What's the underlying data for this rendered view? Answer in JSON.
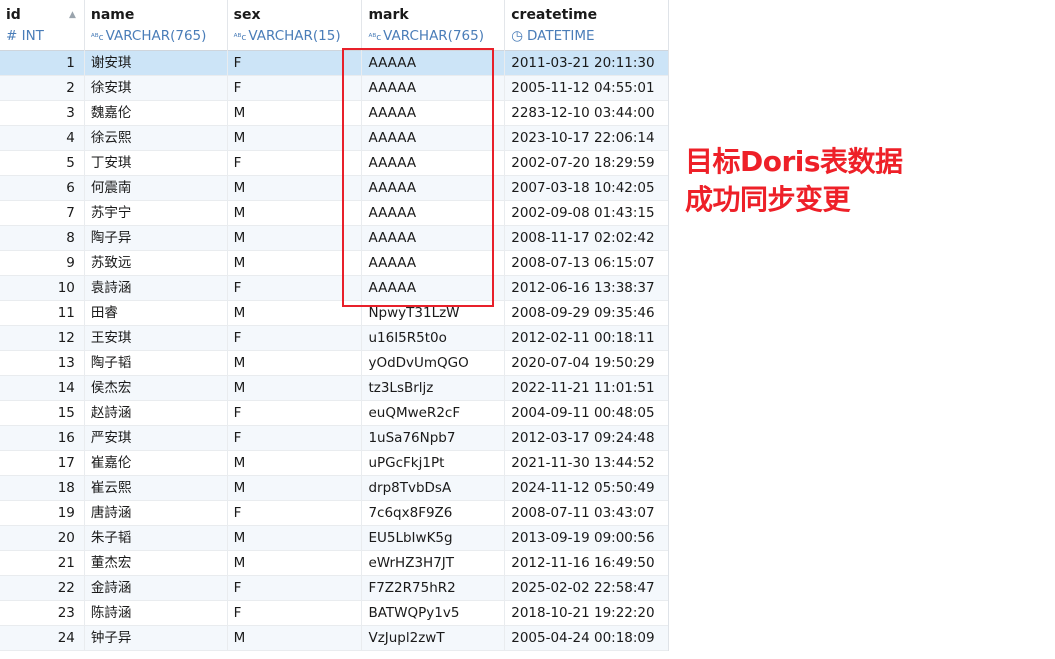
{
  "columns": [
    {
      "name": "id",
      "type": "# INT",
      "type_icon": "hash-icon"
    },
    {
      "name": "name",
      "type": "VARCHAR(765)",
      "type_icon": "text-type-icon"
    },
    {
      "name": "sex",
      "type": "VARCHAR(15)",
      "type_icon": "text-type-icon"
    },
    {
      "name": "mark",
      "type": "VARCHAR(765)",
      "type_icon": "text-type-icon"
    },
    {
      "name": "createtime",
      "type": "DATETIME",
      "type_icon": "clock-icon"
    }
  ],
  "type_icon_text": "ᴬᴮc",
  "clock_glyph": "◷",
  "rows": [
    {
      "id": "1",
      "name": "谢安琪",
      "sex": "F",
      "mark": "AAAAA",
      "createtime": "2011-03-21 20:11:30"
    },
    {
      "id": "2",
      "name": "徐安琪",
      "sex": "F",
      "mark": "AAAAA",
      "createtime": "2005-11-12 04:55:01"
    },
    {
      "id": "3",
      "name": "魏嘉伦",
      "sex": "M",
      "mark": "AAAAA",
      "createtime": "2283-12-10 03:44:00"
    },
    {
      "id": "4",
      "name": "徐云熙",
      "sex": "M",
      "mark": "AAAAA",
      "createtime": "2023-10-17 22:06:14"
    },
    {
      "id": "5",
      "name": "丁安琪",
      "sex": "F",
      "mark": "AAAAA",
      "createtime": "2002-07-20 18:29:59"
    },
    {
      "id": "6",
      "name": "何震南",
      "sex": "M",
      "mark": "AAAAA",
      "createtime": "2007-03-18 10:42:05"
    },
    {
      "id": "7",
      "name": "苏宇宁",
      "sex": "M",
      "mark": "AAAAA",
      "createtime": "2002-09-08 01:43:15"
    },
    {
      "id": "8",
      "name": "陶子异",
      "sex": "M",
      "mark": "AAAAA",
      "createtime": "2008-11-17 02:02:42"
    },
    {
      "id": "9",
      "name": "苏致远",
      "sex": "M",
      "mark": "AAAAA",
      "createtime": "2008-07-13 06:15:07"
    },
    {
      "id": "10",
      "name": "袁詩涵",
      "sex": "F",
      "mark": "AAAAA",
      "createtime": "2012-06-16 13:38:37"
    },
    {
      "id": "11",
      "name": "田睿",
      "sex": "M",
      "mark": "NpwyT31LzW",
      "createtime": "2008-09-29 09:35:46"
    },
    {
      "id": "12",
      "name": "王安琪",
      "sex": "F",
      "mark": "u16I5R5t0o",
      "createtime": "2012-02-11 00:18:11"
    },
    {
      "id": "13",
      "name": "陶子韬",
      "sex": "M",
      "mark": "yOdDvUmQGO",
      "createtime": "2020-07-04 19:50:29"
    },
    {
      "id": "14",
      "name": "侯杰宏",
      "sex": "M",
      "mark": "tz3LsBrljz",
      "createtime": "2022-11-21 11:01:51"
    },
    {
      "id": "15",
      "name": "赵詩涵",
      "sex": "F",
      "mark": "euQMweR2cF",
      "createtime": "2004-09-11 00:48:05"
    },
    {
      "id": "16",
      "name": "严安琪",
      "sex": "F",
      "mark": "1uSa76Npb7",
      "createtime": "2012-03-17 09:24:48"
    },
    {
      "id": "17",
      "name": "崔嘉伦",
      "sex": "M",
      "mark": "uPGcFkj1Pt",
      "createtime": "2021-11-30 13:44:52"
    },
    {
      "id": "18",
      "name": "崔云熙",
      "sex": "M",
      "mark": "drp8TvbDsA",
      "createtime": "2024-11-12 05:50:49"
    },
    {
      "id": "19",
      "name": "唐詩涵",
      "sex": "F",
      "mark": "7c6qx8F9Z6",
      "createtime": "2008-07-11 03:43:07"
    },
    {
      "id": "20",
      "name": "朱子韬",
      "sex": "M",
      "mark": "EU5LbIwK5g",
      "createtime": "2013-09-19 09:00:56"
    },
    {
      "id": "21",
      "name": "董杰宏",
      "sex": "M",
      "mark": "eWrHZ3H7JT",
      "createtime": "2012-11-16 16:49:50"
    },
    {
      "id": "22",
      "name": "金詩涵",
      "sex": "F",
      "mark": "F7Z2R75hR2",
      "createtime": "2025-02-02 22:58:47"
    },
    {
      "id": "23",
      "name": "陈詩涵",
      "sex": "F",
      "mark": "BATWQPy1v5",
      "createtime": "2018-10-21 19:22:20"
    },
    {
      "id": "24",
      "name": "钟子异",
      "sex": "M",
      "mark": "VzJupl2zwT",
      "createtime": "2005-04-24 00:18:09"
    }
  ],
  "selected_row": "1",
  "annotation": {
    "line1": "目标Doris表数据",
    "line2": "成功同步变更",
    "color": "#ee2028"
  },
  "highlight_color": "#e8202a",
  "colors": {
    "selected_row": "#cce4f7",
    "type_text": "#4a7db8"
  }
}
